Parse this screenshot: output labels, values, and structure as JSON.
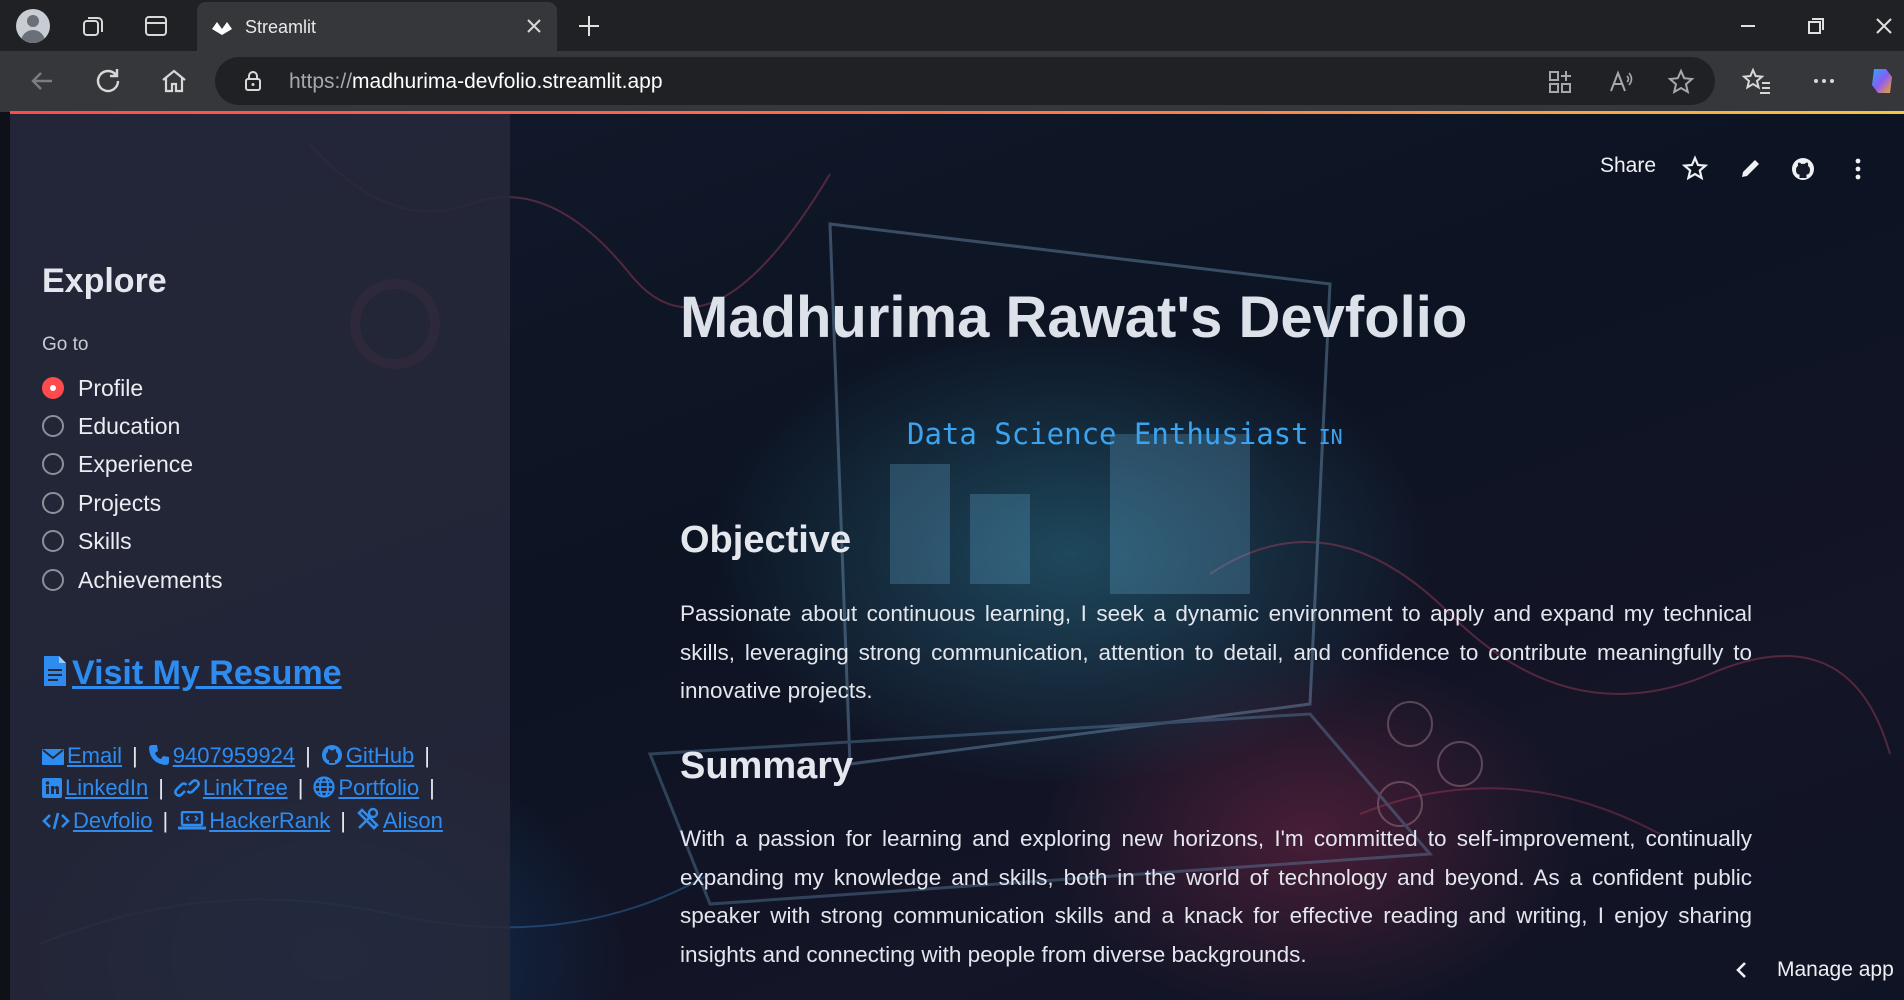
{
  "browser": {
    "tab_title": "Streamlit",
    "url_protocol": "https://",
    "url_host": "madhurima-devfolio.streamlit.app",
    "icons": [
      "profile-avatar",
      "workspaces-icon",
      "tab-actions-icon",
      "streamlit-favicon",
      "close-tab-icon",
      "new-tab-icon",
      "minimize-icon",
      "restore-icon",
      "close-window-icon",
      "back-icon",
      "refresh-icon",
      "home-icon",
      "lock-icon",
      "app-available-icon",
      "read-aloud-icon",
      "favorite-star-icon",
      "favorites-icon",
      "more-icon",
      "copilot-icon"
    ]
  },
  "sidebar": {
    "heading": "Explore",
    "nav_label": "Go to",
    "nav_options": [
      "Profile",
      "Education",
      "Experience",
      "Projects",
      "Skills",
      "Achievements"
    ],
    "selected": "Profile",
    "resume_link": "Visit My Resume",
    "links": {
      "email": "Email",
      "phone": "9407959924",
      "github": "GitHub",
      "linkedin": "LinkedIn",
      "linktree": "LinkTree",
      "portfolio": "Portfolio",
      "devfolio": "Devfolio",
      "hackerrank": "HackerRank",
      "alison": "Alison"
    },
    "separator": "|"
  },
  "toolbar": {
    "share": "Share"
  },
  "main": {
    "title": "Madhurima Rawat's Devfolio",
    "subtitle": "Data Science Enthusiast",
    "flag": "IN",
    "objective_heading": "Objective",
    "objective_text": "Passionate about continuous learning, I seek a dynamic environment to apply and expand my technical skills, leveraging strong communication, attention to detail, and confidence to contribute meaningfully to innovative projects.",
    "summary_heading": "Summary",
    "summary_text": "With a passion for learning and exploring new horizons, I'm committed to self-improvement, continually expanding my knowledge and skills, both in the world of technology and beyond. As a confident public speaker with strong communication skills and a knack for effective reading and writing, I enjoy sharing insights and connecting with people from diverse backgrounds."
  },
  "footer": {
    "manage_app": "Manage app"
  },
  "colors": {
    "accent": "#ff4b4b",
    "link": "#2e8cf0",
    "subtitle": "#3ba3f0",
    "sidebar_bg": "#26293a"
  }
}
